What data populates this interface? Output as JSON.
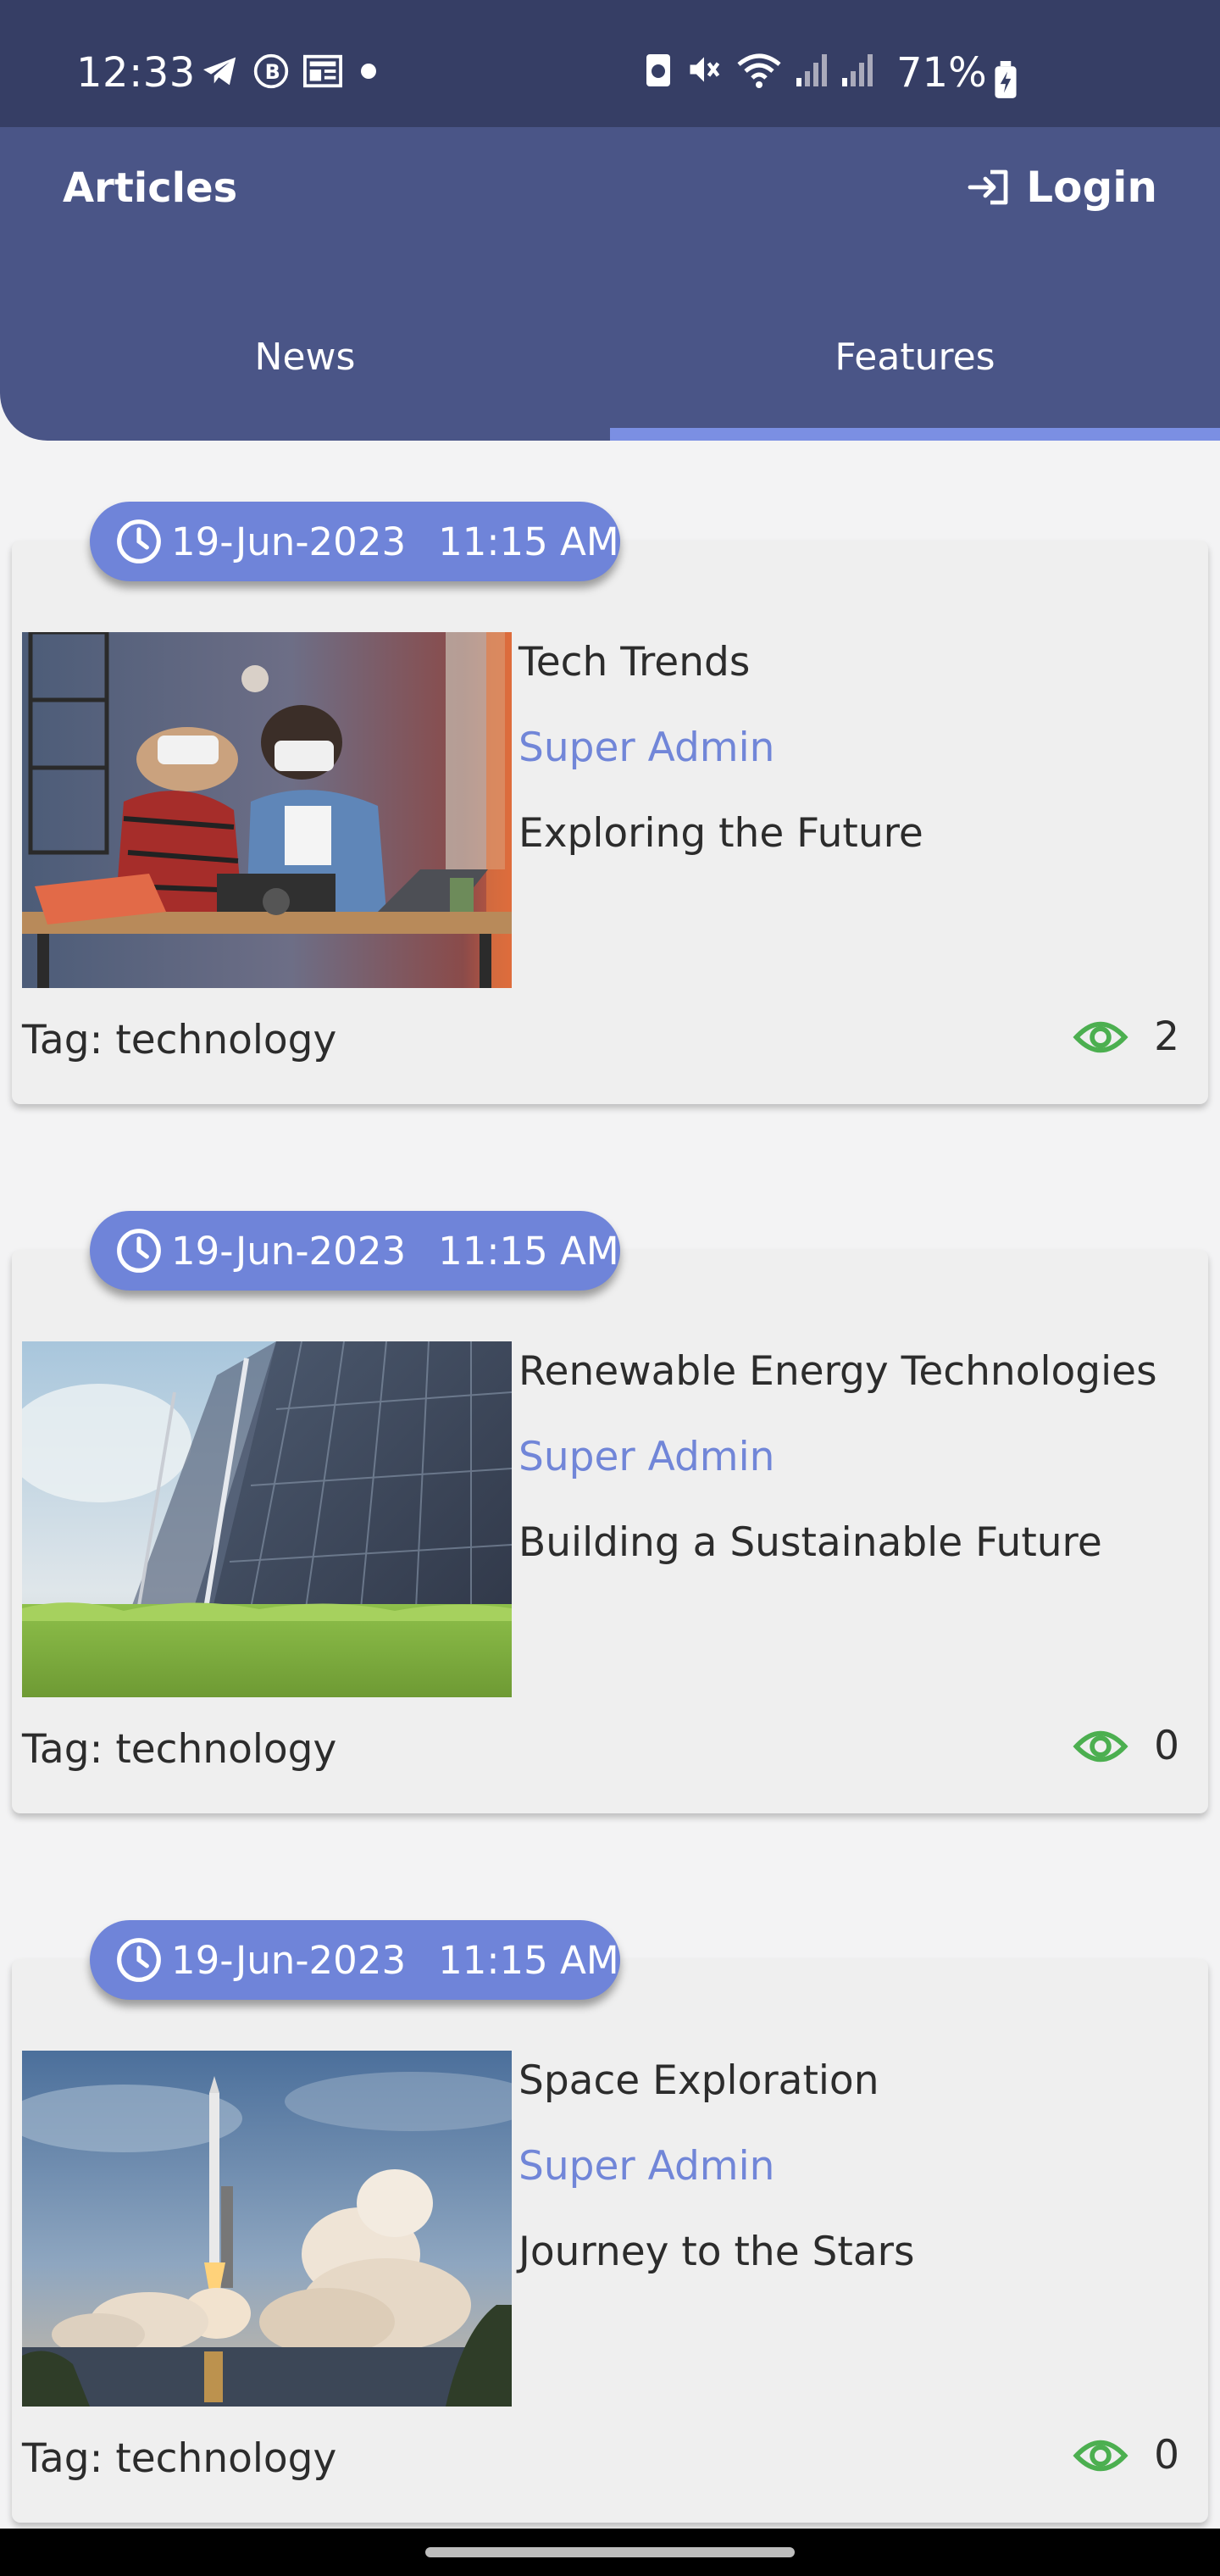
{
  "status_bar": {
    "time": "12:33",
    "battery_percent": "71%",
    "left_icons": [
      "telegram-icon",
      "b-circle-icon",
      "news-icon",
      "dot-icon"
    ],
    "right_icons": [
      "recycle-icon",
      "mute-icon",
      "wifi-icon",
      "signal-icon",
      "signal-icon",
      "battery-charging-icon"
    ]
  },
  "app_bar": {
    "title": "Articles",
    "login_label": "Login",
    "login_icon": "login-icon"
  },
  "tabs": [
    {
      "label": "News",
      "active": false
    },
    {
      "label": "Features",
      "active": true
    }
  ],
  "colors": {
    "status_bar": "#363e65",
    "app_bar": "#4a5587",
    "accent": "#7186d8",
    "views_icon": "#4caf50"
  },
  "articles": [
    {
      "date": "19-Jun-2023",
      "time": "11:15 AM",
      "title": "Tech Trends",
      "author": "Super Admin",
      "subtitle": "Exploring the Future",
      "tag": "Tag: technology",
      "views": "2",
      "image": "vr-headset-workshop-image"
    },
    {
      "date": "19-Jun-2023",
      "time": "11:15 AM",
      "title": "Renewable Energy Technologies",
      "author": "Super Admin",
      "subtitle": "Building a Sustainable Future",
      "tag": "Tag: technology",
      "views": "0",
      "image": "solar-panel-image"
    },
    {
      "date": "19-Jun-2023",
      "time": "11:15 AM",
      "title": "Space Exploration",
      "author": "Super Admin",
      "subtitle": "Journey to the Stars",
      "tag": "Tag: technology",
      "views": "0",
      "image": "rocket-launch-image"
    }
  ]
}
